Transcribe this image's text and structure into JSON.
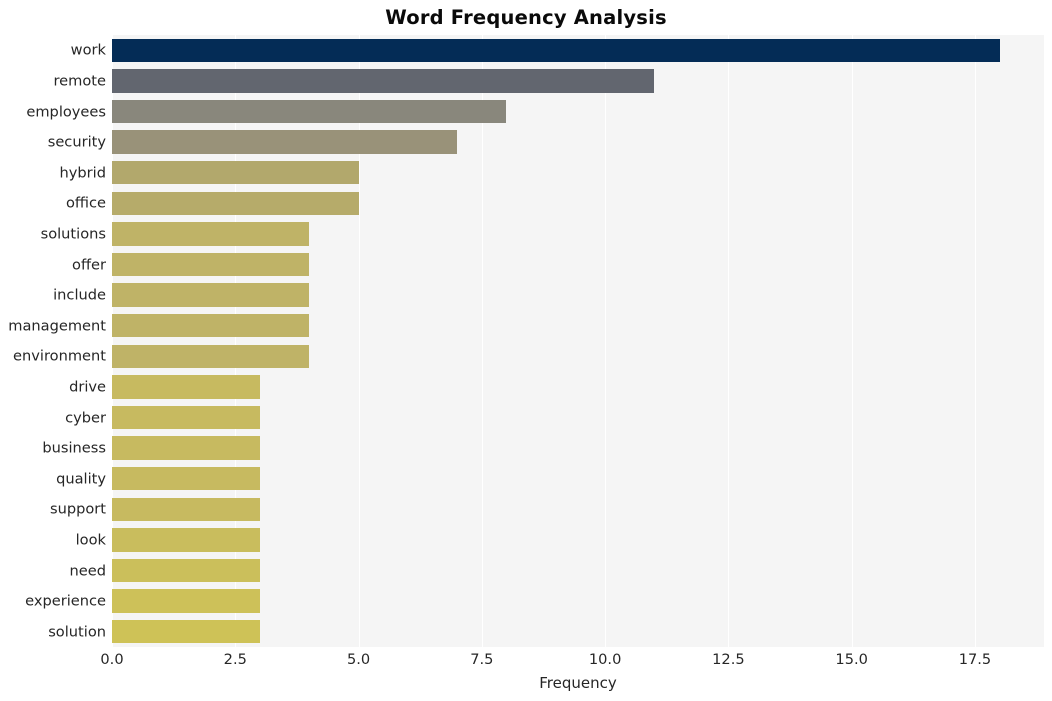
{
  "chart_data": {
    "type": "bar",
    "orientation": "horizontal",
    "title": "Word Frequency Analysis",
    "xlabel": "Frequency",
    "ylabel": "",
    "xlim": [
      0,
      18.9
    ],
    "xticks": [
      "0.0",
      "2.5",
      "5.0",
      "7.5",
      "10.0",
      "12.5",
      "15.0",
      "17.5"
    ],
    "xtick_values": [
      0.0,
      2.5,
      5.0,
      7.5,
      10.0,
      12.5,
      15.0,
      17.5
    ],
    "grid": "vertical-white-on-light",
    "legend": "none",
    "categories": [
      "work",
      "remote",
      "employees",
      "security",
      "hybrid",
      "office",
      "solutions",
      "offer",
      "include",
      "management",
      "environment",
      "drive",
      "cyber",
      "business",
      "quality",
      "support",
      "look",
      "need",
      "experience",
      "solution"
    ],
    "values": [
      18,
      11,
      8,
      7,
      5,
      5,
      4,
      4,
      4,
      4,
      4,
      3,
      3,
      3,
      3,
      3,
      3,
      3,
      3,
      3
    ],
    "bar_colors": [
      "#042c56",
      "#62666f",
      "#89877c",
      "#999279",
      "#b2a86c",
      "#b6ab6a",
      "#bfb367",
      "#bfb367",
      "#bfb367",
      "#bfb367",
      "#bfb367",
      "#c7ba60",
      "#c7ba60",
      "#c7ba60",
      "#c7ba60",
      "#c7ba60",
      "#c9bd5d",
      "#cbbf5b",
      "#cdc159",
      "#cec257"
    ],
    "plot_background": "#f5f5f5",
    "grid_color": "#ffffff",
    "figure_background": "#ffffff",
    "text_color": "#262626",
    "title_color": "#0a0a0a"
  }
}
